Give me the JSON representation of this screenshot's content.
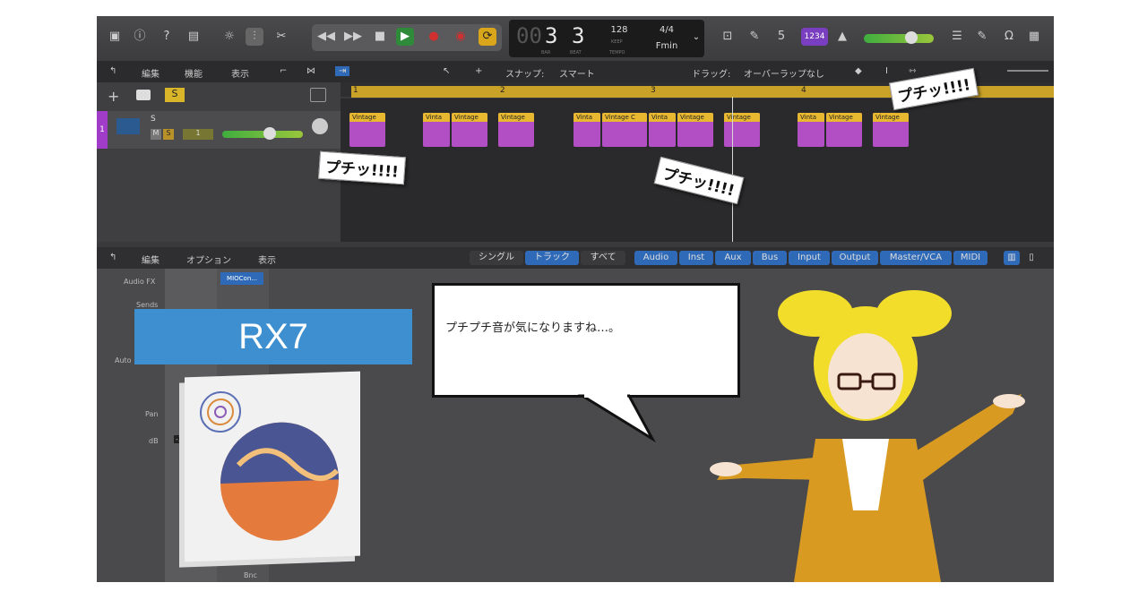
{
  "toolbar": {
    "lcd": {
      "bar": "3",
      "beat": "3",
      "bar_dim": "00",
      "bar_caption": "BAR",
      "beat_caption": "BEAT",
      "tempo": "128",
      "tempo_caption": "KEEP",
      "tempo_sub": "TEMPO",
      "signature": "4/4",
      "key": "Fmin"
    },
    "tuner_label": "1234"
  },
  "editbar": {
    "edit": "編集",
    "function": "機能",
    "view": "表示",
    "snap_label": "スナップ:",
    "snap_value": "スマート",
    "drag_label": "ドラッグ:",
    "drag_value": "オーバーラップなし"
  },
  "ruler": {
    "marks": [
      "1",
      "2",
      "3",
      "4"
    ]
  },
  "track": {
    "number": "1",
    "name": "S",
    "mute": "M",
    "solo": "S",
    "rec": "1"
  },
  "regions": [
    "Vintage",
    "Vinta",
    "Vintage",
    "Vintage",
    "Vinta",
    "Vintage C",
    "Vinta",
    "Vintage",
    "Vintage",
    "Vinta",
    "Vintage",
    "Vintage"
  ],
  "mixer_bar": {
    "edit": "編集",
    "options": "オプション",
    "view": "表示",
    "scope": [
      "シングル",
      "トラック",
      "すべて"
    ],
    "filters": [
      "Audio",
      "Inst",
      "Aux",
      "Bus",
      "Input",
      "Output",
      "Master/VCA",
      "MIDI"
    ]
  },
  "mixer": {
    "audio_fx": "Audio FX",
    "sends": "Sends",
    "auto": "Auto",
    "pan": "Pan",
    "db": "dB",
    "db_value": "-3.1",
    "plugin": "MIOCon...",
    "bnc": "Bnc"
  },
  "callouts": {
    "pchi": "プチッ!!!!"
  },
  "rx": {
    "banner": "RX7"
  },
  "bubble": {
    "text": "プチプチ音が気になりますね…。"
  },
  "colors": {
    "region": "#b34fc4",
    "region_header": "#e8b830",
    "cycle": "#c9a227",
    "accent_blue": "#3d8fd0",
    "filter_blue": "#2e6ab8"
  }
}
